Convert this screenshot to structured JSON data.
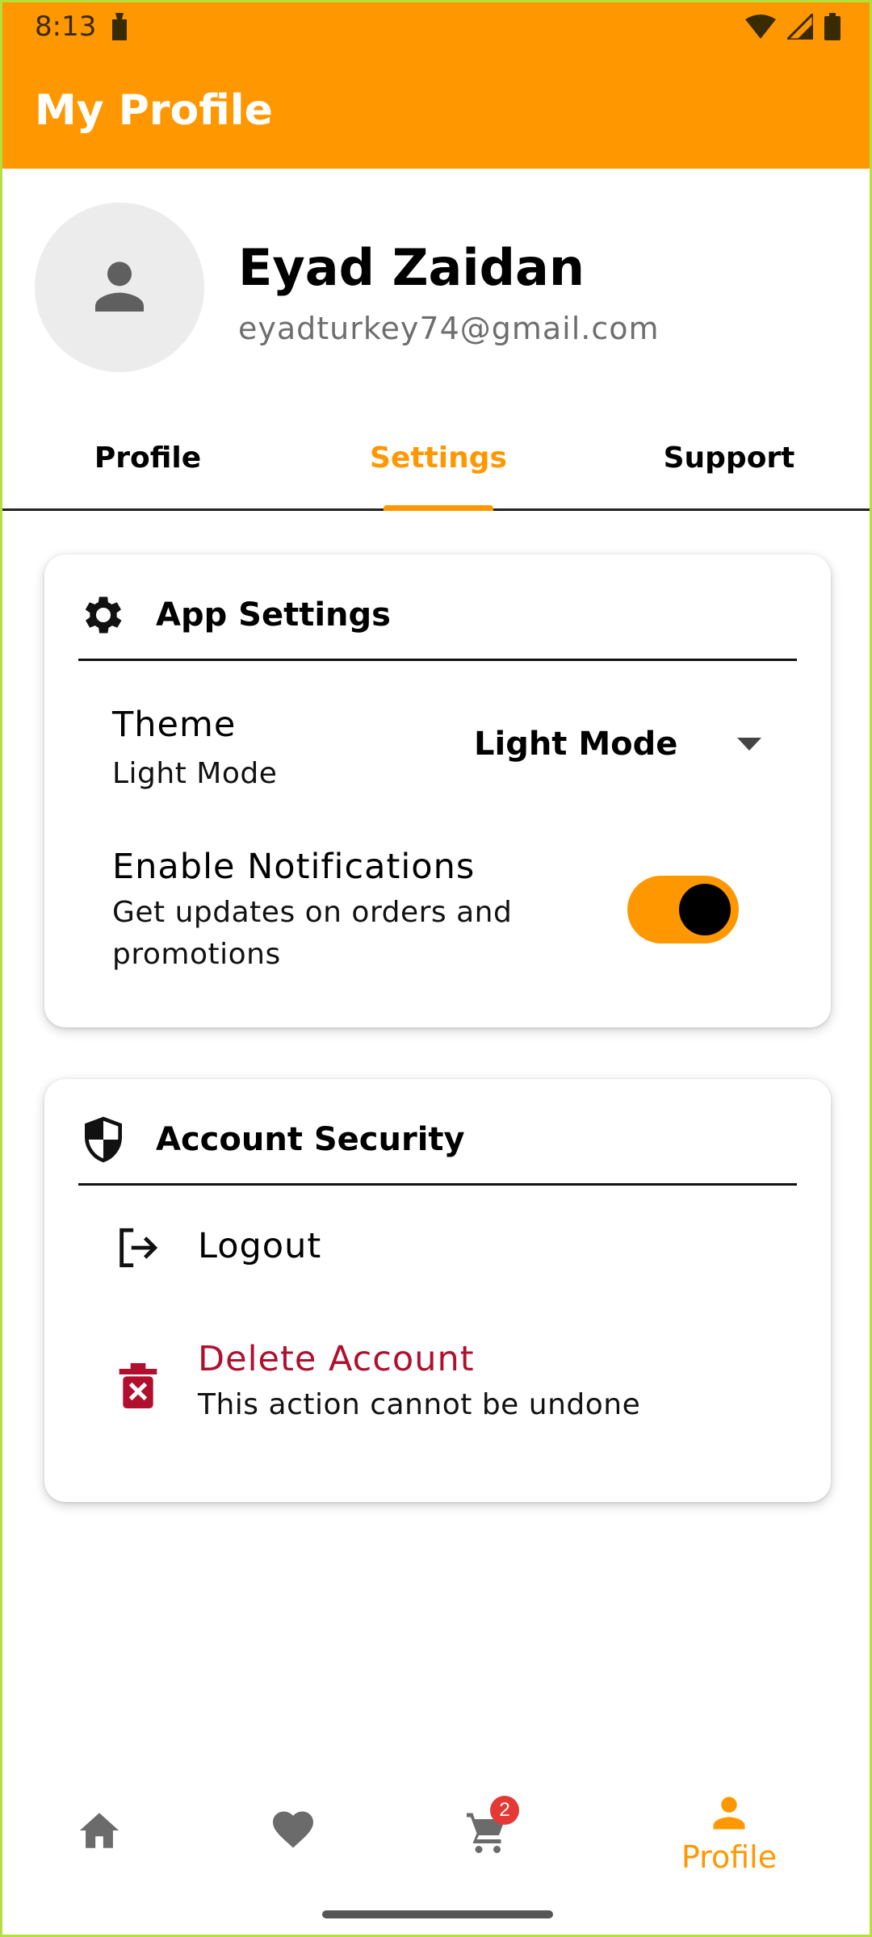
{
  "status_bar": {
    "time": "8:13"
  },
  "app_bar": {
    "title": "My Profile"
  },
  "profile": {
    "name": "Eyad Zaidan",
    "email": "eyadturkey74@gmail.com"
  },
  "tabs": [
    {
      "label": "Profile",
      "active": false
    },
    {
      "label": "Settings",
      "active": true
    },
    {
      "label": "Support",
      "active": false
    }
  ],
  "app_settings": {
    "title": "App Settings",
    "theme": {
      "title": "Theme",
      "subtitle": "Light Mode",
      "selected": "Light Mode"
    },
    "notifications": {
      "title": "Enable Notifications",
      "subtitle": "Get updates on orders and promotions",
      "enabled": true
    }
  },
  "account_security": {
    "title": "Account Security",
    "logout": {
      "label": "Logout"
    },
    "delete": {
      "label": "Delete Account",
      "subtitle": "This action cannot be undone",
      "color": "#b0102e"
    }
  },
  "bottom_nav": {
    "items": [
      {
        "icon": "home-icon"
      },
      {
        "icon": "heart-icon"
      },
      {
        "icon": "cart-icon",
        "badge": "2"
      },
      {
        "icon": "person-icon",
        "label": "Profile",
        "active": true
      }
    ]
  },
  "colors": {
    "accent": "#ff9800",
    "danger": "#b0102e"
  }
}
